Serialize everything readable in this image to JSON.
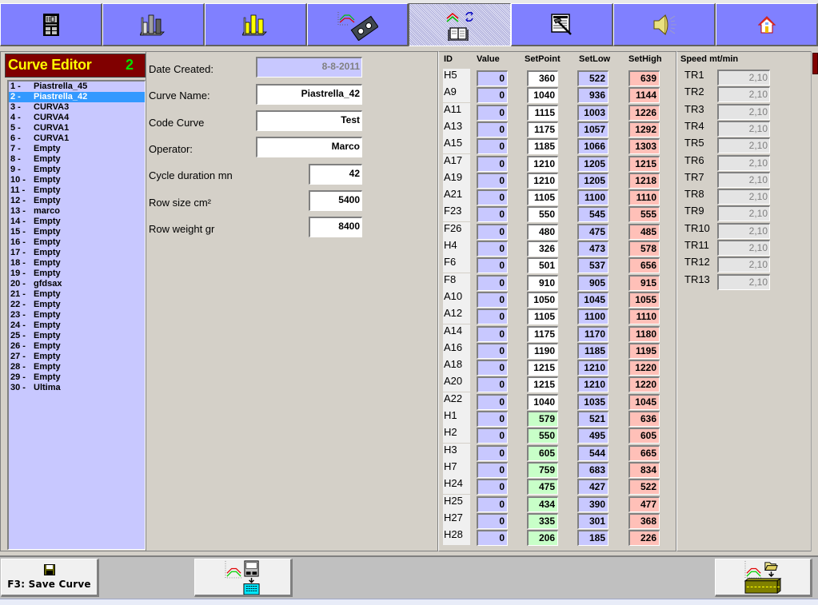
{
  "toolbar": {
    "buttons": [
      {
        "icon": "controller-icon",
        "active": false
      },
      {
        "icon": "gray-bar-chart-icon",
        "active": false
      },
      {
        "icon": "yellow-bar-chart-icon",
        "active": false
      },
      {
        "icon": "curve-tape-icon",
        "active": false
      },
      {
        "icon": "curve-book-icon",
        "active": true
      },
      {
        "icon": "hammer-document-icon",
        "active": false
      },
      {
        "icon": "speaker-icon",
        "active": false
      },
      {
        "icon": "home-icon",
        "active": false
      }
    ]
  },
  "editor": {
    "title": "Curve Editor",
    "selected_number": "2"
  },
  "curves": [
    {
      "num": "1 -",
      "name": "Piastrella_45"
    },
    {
      "num": "2 -",
      "name": "Piastrella_42",
      "selected": true
    },
    {
      "num": "3 -",
      "name": "CURVA3"
    },
    {
      "num": "4 -",
      "name": "CURVA4"
    },
    {
      "num": "5 -",
      "name": "CURVA1"
    },
    {
      "num": "6 -",
      "name": "CURVA1"
    },
    {
      "num": "7 -",
      "name": "Empty"
    },
    {
      "num": "8 -",
      "name": "Empty"
    },
    {
      "num": "9 -",
      "name": "Empty"
    },
    {
      "num": "10 -",
      "name": "Empty"
    },
    {
      "num": "11 -",
      "name": "Empty"
    },
    {
      "num": "12 -",
      "name": "Empty"
    },
    {
      "num": "13 -",
      "name": "marco"
    },
    {
      "num": "14 -",
      "name": "Empty"
    },
    {
      "num": "15 -",
      "name": "Empty"
    },
    {
      "num": "16 -",
      "name": "Empty"
    },
    {
      "num": "17 -",
      "name": "Empty"
    },
    {
      "num": "18 -",
      "name": "Empty"
    },
    {
      "num": "19 -",
      "name": "Empty"
    },
    {
      "num": "20 -",
      "name": "gfdsax"
    },
    {
      "num": "21 -",
      "name": "Empty"
    },
    {
      "num": "22 -",
      "name": "Empty"
    },
    {
      "num": "23 -",
      "name": "Empty"
    },
    {
      "num": "24 -",
      "name": "Empty"
    },
    {
      "num": "25 -",
      "name": "Empty"
    },
    {
      "num": "26 -",
      "name": "Empty"
    },
    {
      "num": "27 -",
      "name": "Empty"
    },
    {
      "num": "28 -",
      "name": "Empty"
    },
    {
      "num": "29 -",
      "name": "Empty"
    },
    {
      "num": "30 -",
      "name": "Ultima"
    }
  ],
  "form": {
    "date_created_label": "Date Created:",
    "date_created_value": "8-8-2011",
    "curve_name_label": "Curve Name:",
    "curve_name_value": "Piastrella_42",
    "code_curve_label": "Code Curve",
    "code_curve_value": "Test",
    "operator_label": "Operator:",
    "operator_value": "Marco",
    "cycle_duration_label": "Cycle duration mn",
    "cycle_duration_value": "42",
    "row_size_label": "Row size cm²",
    "row_size_value": "5400",
    "row_weight_label": "Row weight gr",
    "row_weight_value": "8400"
  },
  "table": {
    "headers": {
      "id": "ID",
      "value": "Value",
      "setpoint": "SetPoint",
      "setlow": "SetLow",
      "sethigh": "SetHigh"
    },
    "rows": [
      {
        "id": "H5",
        "value": "0",
        "setpoint": "360",
        "setlow": "522",
        "sethigh": "639",
        "sp_color": "white"
      },
      {
        "id": "A9",
        "value": "0",
        "setpoint": "1040",
        "setlow": "936",
        "sethigh": "1144",
        "sp_color": "white"
      },
      {
        "id": "A11",
        "value": "0",
        "setpoint": "1115",
        "setlow": "1003",
        "sethigh": "1226",
        "sp_color": "white"
      },
      {
        "id": "A13",
        "value": "0",
        "setpoint": "1175",
        "setlow": "1057",
        "sethigh": "1292",
        "sp_color": "white"
      },
      {
        "id": "A15",
        "value": "0",
        "setpoint": "1185",
        "setlow": "1066",
        "sethigh": "1303",
        "sp_color": "white"
      },
      {
        "id": "A17",
        "value": "0",
        "setpoint": "1210",
        "setlow": "1205",
        "sethigh": "1215",
        "sp_color": "white"
      },
      {
        "id": "A19",
        "value": "0",
        "setpoint": "1210",
        "setlow": "1205",
        "sethigh": "1218",
        "sp_color": "white"
      },
      {
        "id": "A21",
        "value": "0",
        "setpoint": "1105",
        "setlow": "1100",
        "sethigh": "1110",
        "sp_color": "white"
      },
      {
        "id": "F23",
        "value": "0",
        "setpoint": "550",
        "setlow": "545",
        "sethigh": "555",
        "sp_color": "white"
      },
      {
        "id": "F26",
        "value": "0",
        "setpoint": "480",
        "setlow": "475",
        "sethigh": "485",
        "sp_color": "white"
      },
      {
        "id": "H4",
        "value": "0",
        "setpoint": "326",
        "setlow": "473",
        "sethigh": "578",
        "sp_color": "white"
      },
      {
        "id": "F6",
        "value": "0",
        "setpoint": "501",
        "setlow": "537",
        "sethigh": "656",
        "sp_color": "white"
      },
      {
        "id": "F8",
        "value": "0",
        "setpoint": "910",
        "setlow": "905",
        "sethigh": "915",
        "sp_color": "white"
      },
      {
        "id": "A10",
        "value": "0",
        "setpoint": "1050",
        "setlow": "1045",
        "sethigh": "1055",
        "sp_color": "white"
      },
      {
        "id": "A12",
        "value": "0",
        "setpoint": "1105",
        "setlow": "1100",
        "sethigh": "1110",
        "sp_color": "white"
      },
      {
        "id": "A14",
        "value": "0",
        "setpoint": "1175",
        "setlow": "1170",
        "sethigh": "1180",
        "sp_color": "white"
      },
      {
        "id": "A16",
        "value": "0",
        "setpoint": "1190",
        "setlow": "1185",
        "sethigh": "1195",
        "sp_color": "white"
      },
      {
        "id": "A18",
        "value": "0",
        "setpoint": "1215",
        "setlow": "1210",
        "sethigh": "1220",
        "sp_color": "white"
      },
      {
        "id": "A20",
        "value": "0",
        "setpoint": "1215",
        "setlow": "1210",
        "sethigh": "1220",
        "sp_color": "white"
      },
      {
        "id": "A22",
        "value": "0",
        "setpoint": "1040",
        "setlow": "1035",
        "sethigh": "1045",
        "sp_color": "white"
      },
      {
        "id": "H1",
        "value": "0",
        "setpoint": "579",
        "setlow": "521",
        "sethigh": "636",
        "sp_color": "green"
      },
      {
        "id": "H2",
        "value": "0",
        "setpoint": "550",
        "setlow": "495",
        "sethigh": "605",
        "sp_color": "green"
      },
      {
        "id": "H3",
        "value": "0",
        "setpoint": "605",
        "setlow": "544",
        "sethigh": "665",
        "sp_color": "green"
      },
      {
        "id": "H7",
        "value": "0",
        "setpoint": "759",
        "setlow": "683",
        "sethigh": "834",
        "sp_color": "green"
      },
      {
        "id": "H24",
        "value": "0",
        "setpoint": "475",
        "setlow": "427",
        "sethigh": "522",
        "sp_color": "green"
      },
      {
        "id": "H25",
        "value": "0",
        "setpoint": "434",
        "setlow": "390",
        "sethigh": "477",
        "sp_color": "green"
      },
      {
        "id": "H27",
        "value": "0",
        "setpoint": "335",
        "setlow": "301",
        "sethigh": "368",
        "sp_color": "green"
      },
      {
        "id": "H28",
        "value": "0",
        "setpoint": "206",
        "setlow": "185",
        "sethigh": "226",
        "sp_color": "green"
      }
    ]
  },
  "speed": {
    "title": "Speed mt/min",
    "rows": [
      {
        "label": "TR1",
        "value": "2,10"
      },
      {
        "label": "TR2",
        "value": "2,10"
      },
      {
        "label": "TR3",
        "value": "2,10"
      },
      {
        "label": "TR4",
        "value": "2,10"
      },
      {
        "label": "TR5",
        "value": "2,10"
      },
      {
        "label": "TR6",
        "value": "2,10"
      },
      {
        "label": "TR7",
        "value": "2,10"
      },
      {
        "label": "TR8",
        "value": "2,10"
      },
      {
        "label": "TR9",
        "value": "2,10"
      },
      {
        "label": "TR10",
        "value": "2,10"
      },
      {
        "label": "TR11",
        "value": "2,10"
      },
      {
        "label": "TR12",
        "value": "2,10"
      },
      {
        "label": "TR13",
        "value": "2,10"
      }
    ]
  },
  "bottom": {
    "save_label": "F3: Save Curve",
    "save_icon": "floppy-disk-icon",
    "export_icon": "curve-to-controller-icon",
    "import_icon": "folder-curve-to-kiln-icon"
  },
  "colors": {
    "toolbar_button": "#8080ff",
    "header_bg": "#800000",
    "header_title": "#ffff00",
    "header_count": "#00e000",
    "list_bg": "#c8c8ff",
    "selected_bg": "#3399ff",
    "setpoint_green": "#c8ffc8",
    "setlow_bg": "#c8c8ff",
    "sethigh_bg": "#ffc0b8"
  }
}
